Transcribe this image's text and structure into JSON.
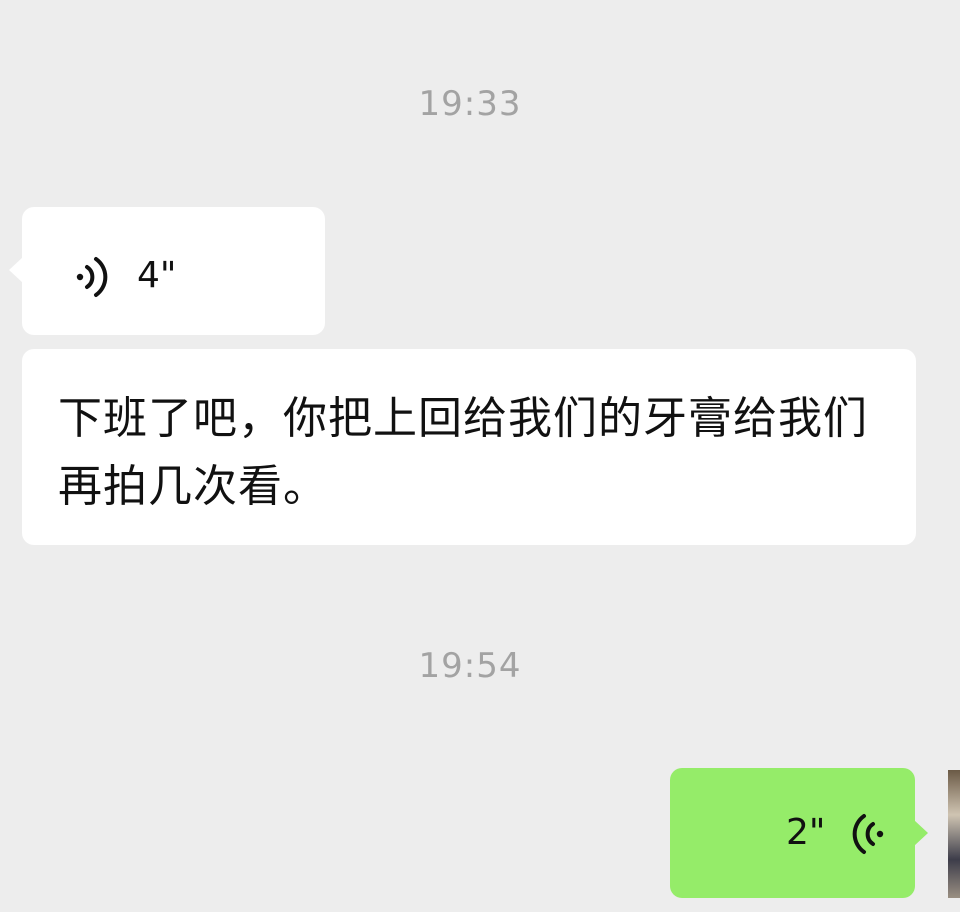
{
  "chat": {
    "timestamp_1": "19:33",
    "voice_in": {
      "duration": "4\"",
      "icon": "voice-wave-icon"
    },
    "text_in": {
      "text": "下班了吧，你把上回给我们的牙膏给我们再拍几次看。"
    },
    "timestamp_2": "19:54",
    "voice_out": {
      "duration": "2\"",
      "icon": "voice-wave-icon"
    }
  },
  "colors": {
    "background": "#ededed",
    "incoming_bubble": "#ffffff",
    "outgoing_bubble": "#95ec69",
    "timestamp_text": "#a3a3a3"
  }
}
